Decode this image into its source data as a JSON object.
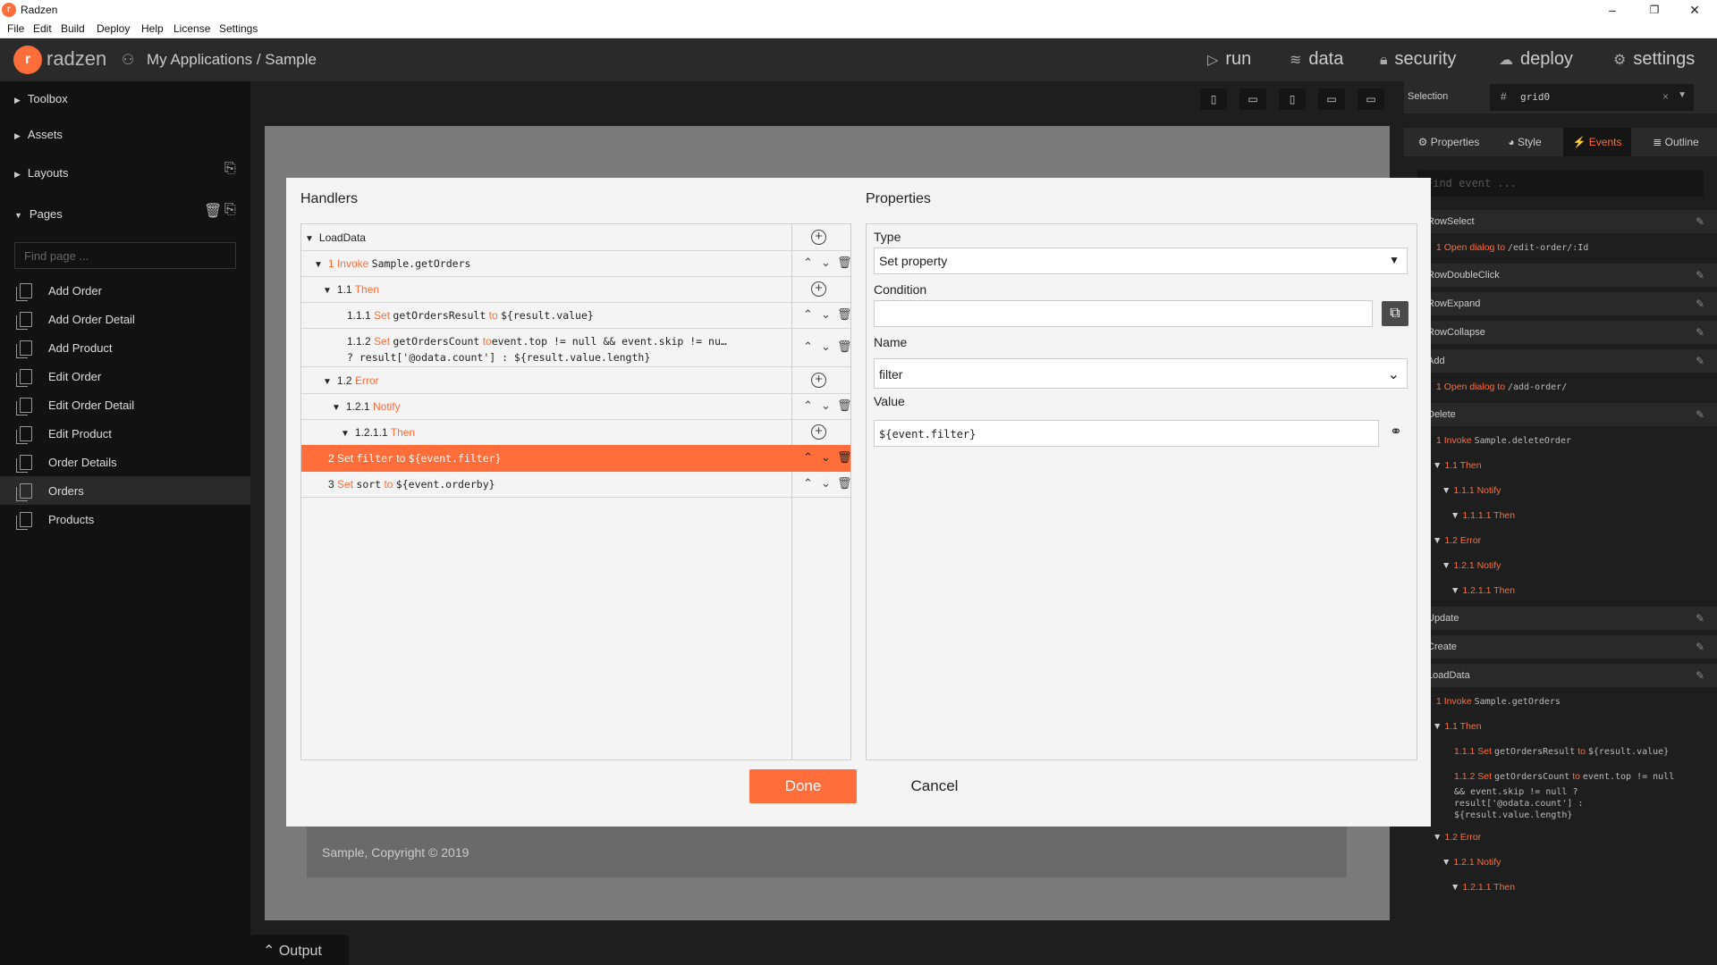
{
  "window": {
    "title": "Radzen",
    "app_icon": "radzen-logo-icon"
  },
  "menu": [
    "File",
    "Edit",
    "Build",
    "Deploy",
    "Help",
    "License",
    "Settings"
  ],
  "header": {
    "logo_text": "radzen",
    "breadcrumb": "My Applications / Sample",
    "nav": [
      {
        "label": "run",
        "icon": "play-icon"
      },
      {
        "label": "data",
        "icon": "layers-icon"
      },
      {
        "label": "security",
        "icon": "lock-icon"
      },
      {
        "label": "deploy",
        "icon": "cloud-upload-icon"
      },
      {
        "label": "settings",
        "icon": "gear-icon"
      }
    ]
  },
  "sidebar": {
    "sections": [
      "Toolbox",
      "Assets",
      "Layouts",
      "Pages"
    ],
    "find_page_placeholder": "Find page ...",
    "pages": [
      "Add Order",
      "Add Order Detail",
      "Add Product",
      "Edit Order",
      "Edit Order Detail",
      "Edit Product",
      "Order Details",
      "Orders",
      "Products"
    ],
    "active_page": "Orders"
  },
  "canvas": {
    "footer": "Sample, Copyright © 2019"
  },
  "output_tab": "Output",
  "right_panel": {
    "selection_label": "Selection",
    "selection_value": "grid0",
    "tabs": [
      "Properties",
      "Style",
      "Events",
      "Outline"
    ],
    "active_tab": "Events",
    "find_event_placeholder": "Find event ...",
    "events": {
      "row_select": "RowSelect",
      "row_select_h1_num": "1",
      "row_select_h1_kw": "Open dialog to",
      "row_select_h1_val": "/edit-order/:Id",
      "row_double_click": "RowDoubleClick",
      "row_expand": "RowExpand",
      "row_collapse": "RowCollapse",
      "add": "Add",
      "add_h1_num": "1",
      "add_h1_kw": "Open dialog to",
      "add_h1_val": "/add-order/",
      "delete": "Delete",
      "del_1_num": "1",
      "del_1_kw": "Invoke",
      "del_1_val": "Sample.deleteOrder",
      "del_11_num": "1.1",
      "del_11_kw": "Then",
      "del_111_num": "1.1.1",
      "del_111_kw": "Notify",
      "del_1111_num": "1.1.1.1",
      "del_1111_kw": "Then",
      "del_12_num": "1.2",
      "del_12_kw": "Error",
      "del_121_num": "1.2.1",
      "del_121_kw": "Notify",
      "del_1211_num": "1.2.1.1",
      "del_1211_kw": "Then",
      "update": "Update",
      "create": "Create",
      "load_data": "LoadData",
      "ld_1_num": "1",
      "ld_1_kw": "Invoke",
      "ld_1_val": "Sample.getOrders",
      "ld_11_num": "1.1",
      "ld_11_kw": "Then",
      "ld_111_num": "1.1.1",
      "ld_111_kw": "Set",
      "ld_111_a": "getOrdersResult",
      "ld_111_to": "to",
      "ld_111_b": "${result.value}",
      "ld_112_num": "1.1.2",
      "ld_112_kw": "Set",
      "ld_112_a": "getOrdersCount",
      "ld_112_to": "to",
      "ld_112_b": "event.top != null",
      "ld_112_c1": "&& event.skip != null ?",
      "ld_112_c2": "result['@odata.count'] :",
      "ld_112_c3": "${result.value.length}",
      "ld_12_num": "1.2",
      "ld_12_kw": "Error",
      "ld_121_num": "1.2.1",
      "ld_121_kw": "Notify",
      "ld_1211_num": "1.2.1.1",
      "ld_1211_kw": "Then"
    }
  },
  "dialog": {
    "handlers_title": "Handlers",
    "properties_title": "Properties",
    "handlers": {
      "load_data": "LoadData",
      "h1_num": "1",
      "h1_kw": "Invoke",
      "h1_val": "Sample.getOrders",
      "h11_num": "1.1",
      "h11_kw": "Then",
      "h111_num": "1.1.1",
      "h111_kw": "Set",
      "h111_a": "getOrdersResult",
      "h111_to": "to",
      "h111_b": "${result.value}",
      "h112_num": "1.1.2",
      "h112_kw": "Set",
      "h112_a": "getOrdersCount",
      "h112_to": "to",
      "h112_b": "event.top != null && event.skip != nu…",
      "h112_line2": "? result['@odata.count'] : ${result.value.length}",
      "h12_num": "1.2",
      "h12_kw": "Error",
      "h121_num": "1.2.1",
      "h121_kw": "Notify",
      "h1211_num": "1.2.1.1",
      "h1211_kw": "Then",
      "h2_num": "2",
      "h2_kw": "Set",
      "h2_a": "filter",
      "h2_to": "to",
      "h2_b": "${event.filter}",
      "h3_num": "3",
      "h3_kw": "Set",
      "h3_a": "sort",
      "h3_to": "to",
      "h3_b": "${event.orderby}"
    },
    "properties": {
      "type_label": "Type",
      "type_value": "Set property",
      "condition_label": "Condition",
      "condition_value": "",
      "name_label": "Name",
      "name_value": "filter",
      "value_label": "Value",
      "value_value": "${event.filter}"
    },
    "done_label": "Done",
    "cancel_label": "Cancel"
  },
  "colors": {
    "accent": "#ff6d3a",
    "dark": "#1f1e1e",
    "sidebar": "#121212",
    "dialog": "#f4f4f4"
  }
}
